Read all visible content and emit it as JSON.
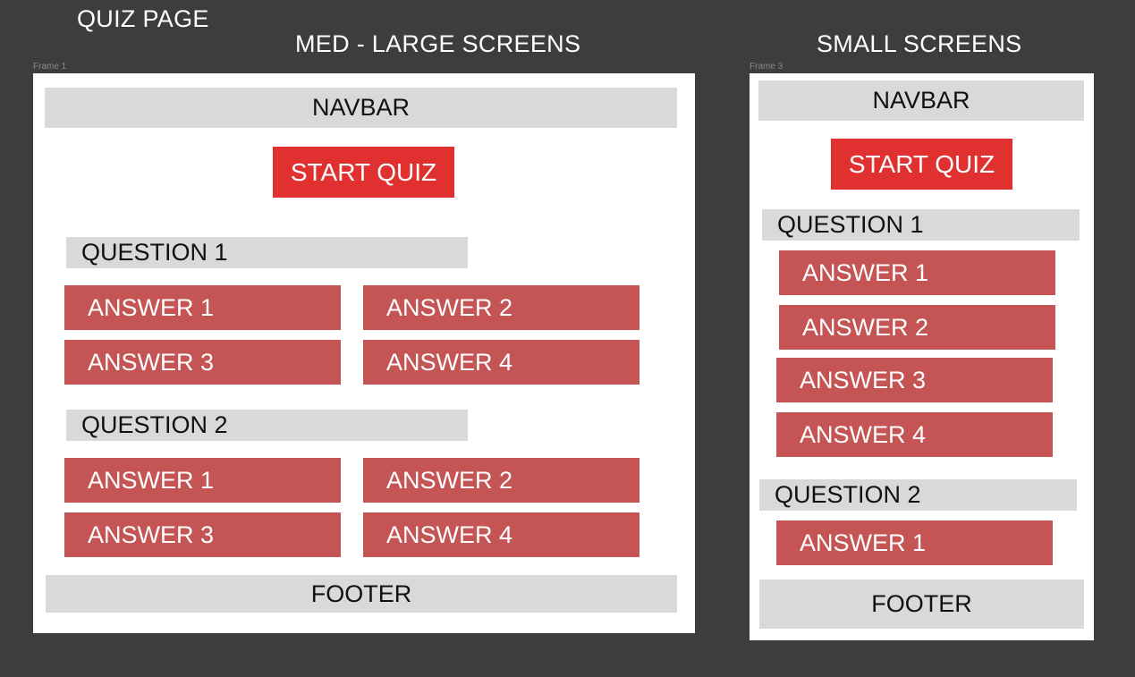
{
  "page_title": "QUIZ PAGE",
  "colors": {
    "background": "#3d3d3d",
    "frame": "#ffffff",
    "placeholder_gray": "#d9d9d9",
    "start_button": "#e0302f",
    "answer_button": "#c55454"
  },
  "large": {
    "heading": "MED - LARGE SCREENS",
    "frame_label": "Frame 1",
    "navbar": "NAVBAR",
    "start_button": "START QUIZ",
    "questions": [
      {
        "label": "QUESTION 1",
        "answers": [
          "ANSWER 1",
          "ANSWER 2",
          "ANSWER 3",
          "ANSWER 4"
        ]
      },
      {
        "label": "QUESTION 2",
        "answers": [
          "ANSWER 1",
          "ANSWER 2",
          "ANSWER 3",
          "ANSWER 4"
        ]
      }
    ],
    "footer": "FOOTER"
  },
  "small": {
    "heading": "SMALL SCREENS",
    "frame_label": "Frame 3",
    "navbar": "NAVBAR",
    "start_button": "START QUIZ",
    "questions": [
      {
        "label": "QUESTION 1",
        "answers": [
          "ANSWER 1",
          "ANSWER 2",
          "ANSWER 3",
          "ANSWER 4"
        ]
      },
      {
        "label": "QUESTION 2",
        "answers": [
          "ANSWER 1"
        ]
      }
    ],
    "footer": "FOOTER"
  }
}
